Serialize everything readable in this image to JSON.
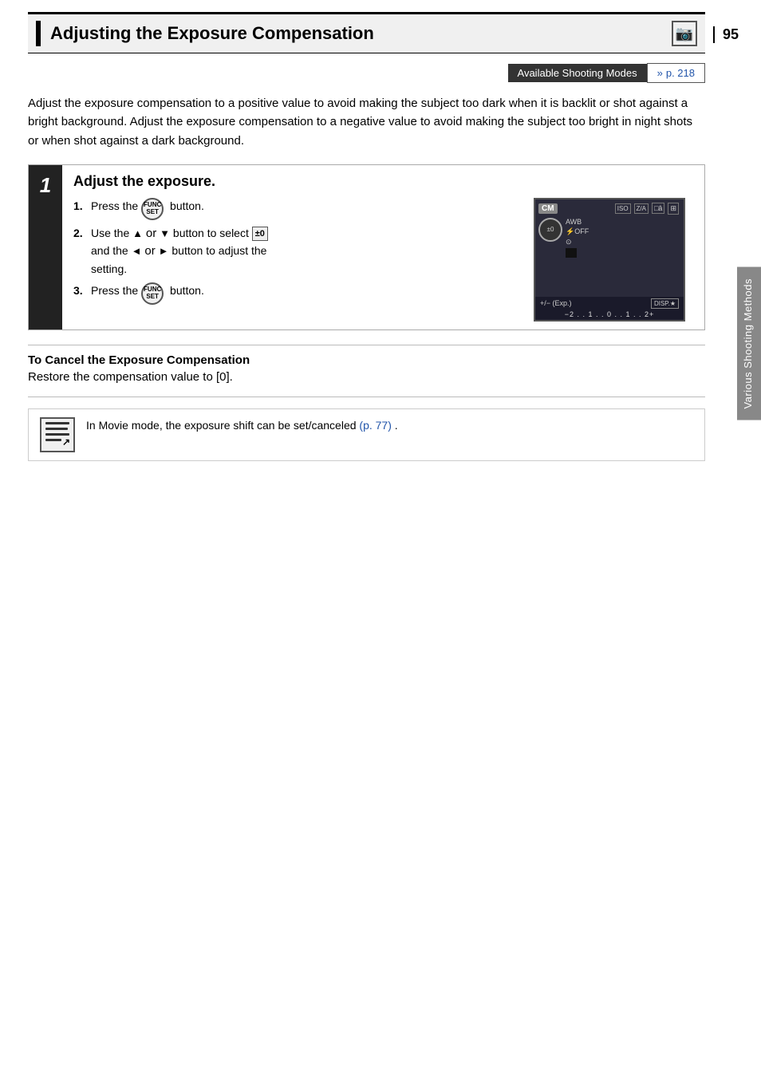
{
  "page": {
    "number": "95",
    "side_tab": "Various Shooting Methods"
  },
  "title": {
    "text": "Adjusting the Exposure Compensation",
    "camera_icon": "📷"
  },
  "modes_bar": {
    "label": "Available Shooting Modes",
    "link_text": "p. 218"
  },
  "intro": {
    "text": "Adjust the exposure compensation to a positive value to avoid making the subject too dark when it is backlit or shot against a bright background. Adjust the exposure compensation to a negative value to avoid making the subject too bright in night shots or when shot against a dark background."
  },
  "step1": {
    "number": "1",
    "title": "Adjust the exposure.",
    "instructions": [
      {
        "num": "1.",
        "text_before": "Press the",
        "button_label": "FUNC SET",
        "text_after": "button."
      },
      {
        "num": "2.",
        "text": "Use the ▲ or ▼ button to select ±0 and the ◄ or ► button to adjust the setting."
      },
      {
        "num": "3.",
        "text_before": "Press the",
        "button_label": "FUNC SET",
        "text_after": "button."
      }
    ]
  },
  "cancel_section": {
    "title": "To Cancel the Exposure Compensation",
    "text": "Restore the compensation value to [0]."
  },
  "note": {
    "text_before": "In Movie mode, the exposure shift can be set/canceled",
    "link_text": "(p. 77)",
    "text_after": "."
  },
  "camera_screen": {
    "cm_badge": "CM",
    "top_icons": [
      "ISO",
      "Z/A",
      "□â"
    ],
    "sub_icon": "⊠",
    "exp_label": "+/−  (Exp.)",
    "disp_label": "DISP.★",
    "scale": "−2 . . 1 . . 0 . . 1 . . 2+"
  }
}
